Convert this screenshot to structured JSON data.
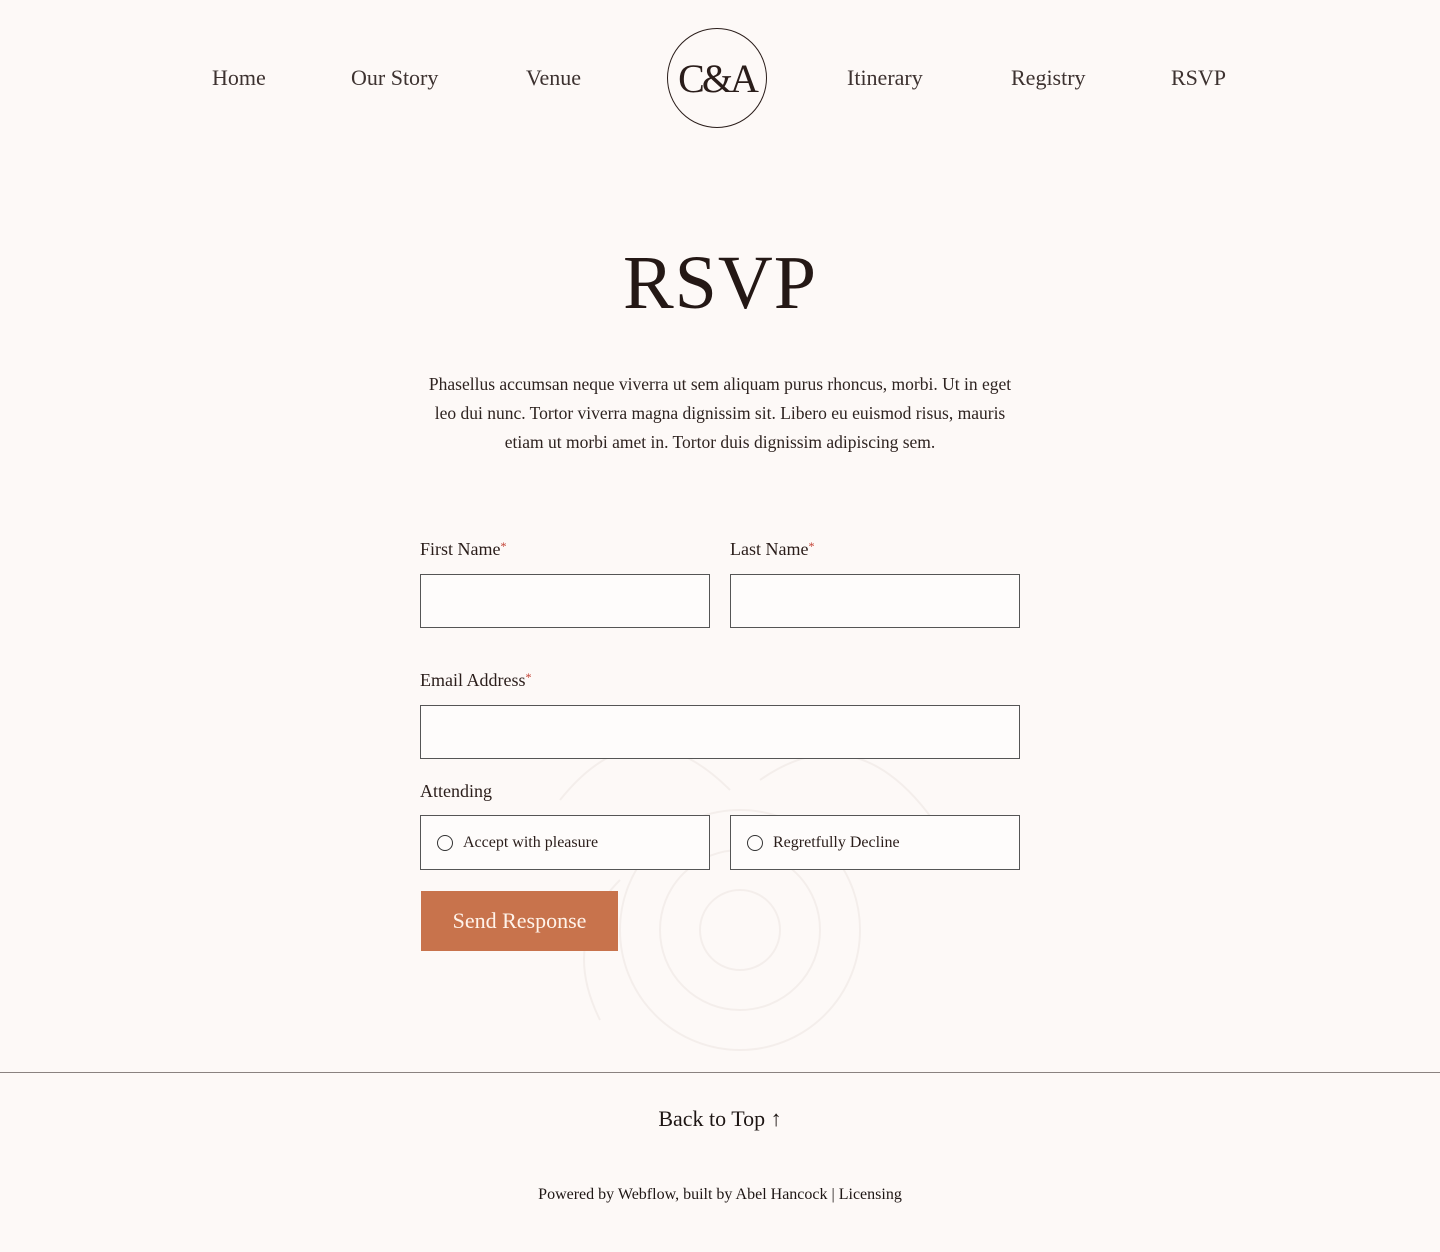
{
  "nav": {
    "left": [
      "Home",
      "Our Story",
      "Venue"
    ],
    "logo": "C&A",
    "right": [
      "Itinerary",
      "Registry",
      "RSVP"
    ]
  },
  "page": {
    "title": "RSVP",
    "intro": "Phasellus accumsan neque viverra ut sem aliquam purus rhoncus, morbi. Ut in eget leo dui nunc. Tortor viverra magna dignissim sit. Libero eu euismod risus, mauris etiam ut morbi amet in. Tortor duis dignissim adipiscing sem."
  },
  "form": {
    "first_name_label": "First Name",
    "last_name_label": "Last Name",
    "email_label": "Email Address",
    "required_marker": "*",
    "first_name_value": "",
    "last_name_value": "",
    "email_value": "",
    "attending_label": "Attending",
    "options": [
      "Accept with pleasure",
      "Regretfully Decline"
    ],
    "submit_label": "Send Response"
  },
  "colors": {
    "accent": "#c8734c",
    "background": "#fdf9f7",
    "required": "#c0392b"
  },
  "footer": {
    "back_to_top": "Back to Top ↑",
    "powered_prefix": "Powered by ",
    "webflow": "Webflow",
    "built_by": ", built by ",
    "author": "Abel Hancock",
    "separator": " | ",
    "licensing": "Licensing"
  }
}
